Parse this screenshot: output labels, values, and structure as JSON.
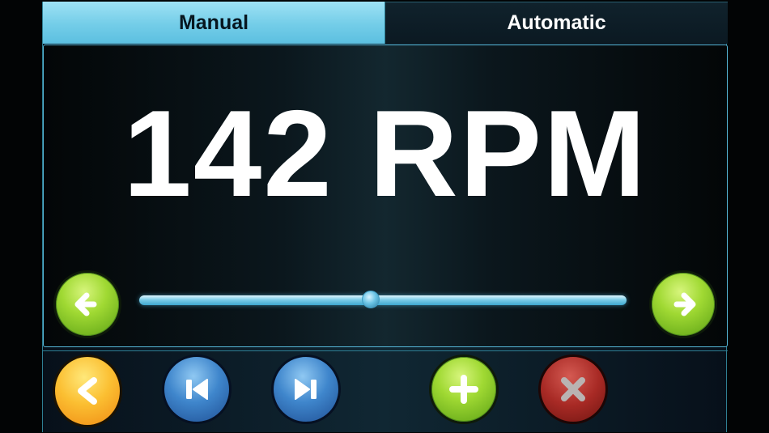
{
  "tabs": [
    {
      "label": "Manual",
      "active": true
    },
    {
      "label": "Automatic",
      "active": false
    }
  ],
  "speed": {
    "display": "142 RPM",
    "slider_fraction": 0.475
  },
  "icons": {
    "left_arrow": "arrow-left-icon",
    "right_arrow": "arrow-right-icon",
    "back": "chevron-left-icon",
    "previous": "skip-previous-icon",
    "next": "skip-next-icon",
    "add": "plus-icon",
    "remove": "close-icon"
  },
  "colors": {
    "tab_active": "#73cde8",
    "accent": "#56b7d8",
    "green": "#8ccf2a",
    "orange": "#f8a823",
    "blue": "#2f6fb8",
    "red": "#9b2420"
  }
}
